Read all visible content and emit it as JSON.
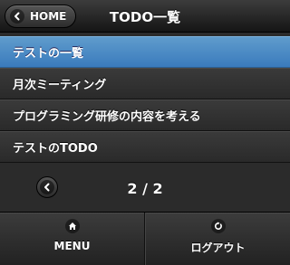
{
  "header": {
    "back_icon": "chevron-left-icon",
    "home_label": "HOME",
    "title": "TODO一覧"
  },
  "list": {
    "items": [
      {
        "label": "テストの一覧",
        "active": true
      },
      {
        "label": "月次ミーティング",
        "active": false
      },
      {
        "label": "プログラミング研修の内容を考える",
        "active": false
      },
      {
        "label": "テストのTODO",
        "active": false
      }
    ]
  },
  "pager": {
    "prev_icon": "chevron-left-icon",
    "indicator": "2 / 2"
  },
  "footer": {
    "menu": {
      "icon": "home-icon",
      "label": "MENU"
    },
    "logout": {
      "icon": "refresh-icon",
      "label": "ログアウト"
    }
  },
  "colors": {
    "active_item": "#4a8cc8",
    "background": "#2b2b2b"
  }
}
